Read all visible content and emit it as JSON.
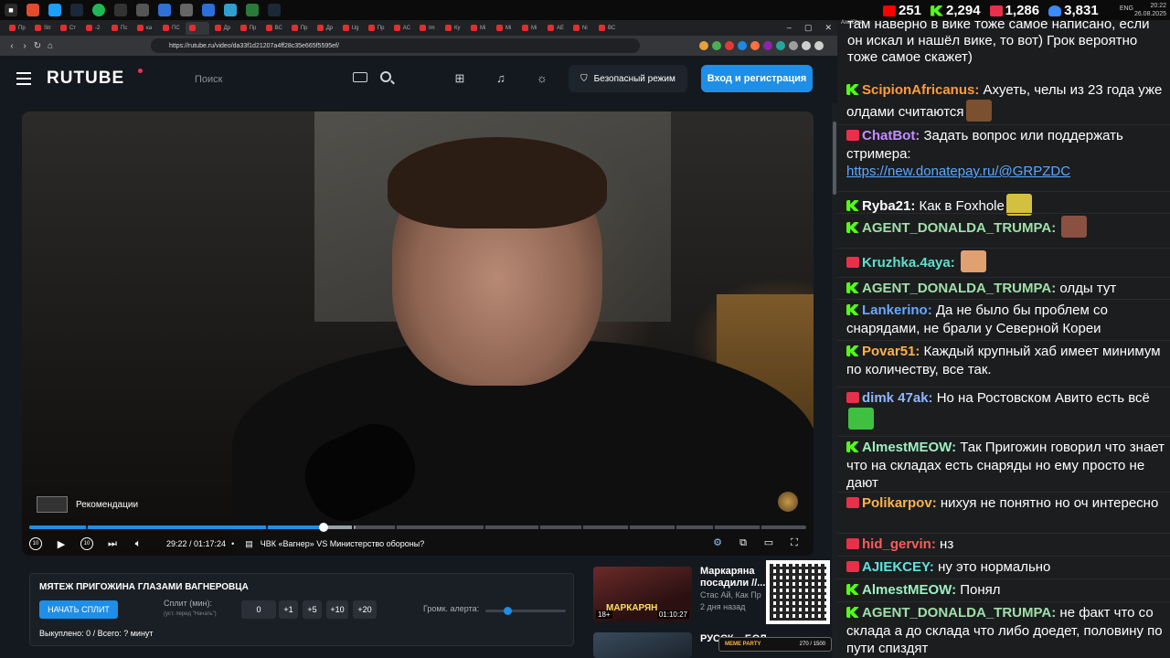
{
  "taskbar": {
    "lang": "ENG",
    "time": "20:22",
    "date": "26.08.2025",
    "stats": [
      {
        "icon": "youtube-icon",
        "color": "#ff0000",
        "value": "251"
      },
      {
        "icon": "kick-icon",
        "color": "#53fc18",
        "value": "2,294"
      },
      {
        "icon": "live-icon",
        "color": "#e8304a",
        "value": "1,286"
      },
      {
        "icon": "viewers-icon",
        "color": "#3b8bff",
        "value": "3,831"
      }
    ]
  },
  "browser": {
    "tabs": [
      "Пр",
      "Str",
      "Ст",
      "-2",
      "Пс",
      "ка",
      "ПС",
      "",
      "Др",
      "Пр",
      "ВС",
      "Пр",
      "Др",
      "Ug",
      "Пр",
      "АС",
      "Im",
      "Ку",
      "Mi",
      "Mi",
      "Mi",
      "АЕ",
      "Ni",
      "ВС"
    ],
    "url": "https://rutube.ru/video/da33f1d21207a4ff28c35e665f5595ef/"
  },
  "rutube": {
    "logo": "RUTUBE",
    "search_placeholder": "Поиск",
    "safe_mode": "Безопасный режим",
    "login": "Вход и регистрация",
    "recommendations": "Рекомендации",
    "player": {
      "time": "29:22 / 01:17:24",
      "separator": "•",
      "chapter": "ЧВК «Вагнер» VS Министерство обороны?",
      "progress_fraction": 0.379,
      "buffered_fraction": 0.42
    }
  },
  "split_panel": {
    "title": "МЯТЕЖ ПРИГОЖИНА ГЛАЗАМИ ВАГНЕРОВЦА",
    "start_button": "НАЧАТЬ СПЛИТ",
    "minutes_label": "Сплит (мин):",
    "hint": "(уст. перед \"Начать\")",
    "value": "0",
    "add_buttons": [
      "+1",
      "+5",
      "+10",
      "+20"
    ],
    "alert_label": "Громк. алерта:",
    "alert_volume_fraction": 0.27,
    "status": "Выкуплено: 0 / Всего: ? минут"
  },
  "related": [
    {
      "title": "Маркаряна посадили //...",
      "channel": "Стас Ай, Как Пр",
      "age": "2 дня назад",
      "age_rating": "18+",
      "duration": "01:10:27",
      "thumb_text": "МАРКАРЯН"
    },
    {
      "title": "РУССК... БОЛ..."
    }
  ],
  "meme_bar": {
    "label": "MEME PARTY",
    "progress": "270 / 1500"
  },
  "chat": {
    "app": "AxelChat",
    "top_cut": "там наверно в вике тоже самое написано, если он искал и нашёл вике, то вот) Грок вероятно тоже самое скажет)",
    "messages": [
      {
        "platform": "kick",
        "nick": "ScipionAfricanus",
        "color": "#ff9c3a",
        "text": "Ахуеть, челы из 23 года уже олдами считаются",
        "emote": "#7a5030"
      },
      {
        "platform": "live",
        "nick": "ChatBot",
        "color": "#c48bff",
        "text": "Задать вопрос или поддержать стримера:",
        "link": "https://new.donatepay.ru/@GRPZDC"
      },
      {
        "platform": "kick",
        "nick": "Ryba21",
        "color": "#ffffff",
        "text": "Как в Foxhole",
        "emote": "#d4c040"
      },
      {
        "platform": "kick",
        "nick": "AGENT_DONALDA_TRUMPA",
        "color": "#9ee0a8",
        "text": "",
        "emote": "#8a5040"
      },
      {
        "platform": "live",
        "nick": "Kruzhka.4aya",
        "color": "#5ee0c8",
        "text": "",
        "emote": "#e0a070"
      },
      {
        "platform": "kick",
        "nick": "AGENT_DONALDA_TRUMPA",
        "color": "#9ee0a8",
        "text": "олды тут"
      },
      {
        "platform": "kick",
        "nick": "Lankerino",
        "color": "#6aa8ff",
        "text": "Да не было бы проблем со снарядами, не брали у Северной Кореи"
      },
      {
        "platform": "kick",
        "nick": "Povar51",
        "color": "#ffb347",
        "text": "Каждый крупный хаб имеет минимум по количеству, все так."
      },
      {
        "platform": "live",
        "nick": "dimk 47ak",
        "color": "#8fb6ff",
        "text": "Но на Ростовском Авито есть всё",
        "emote": "#40c040"
      },
      {
        "platform": "kick",
        "nick": "AlmestMEOW",
        "color": "#9ef0c0",
        "text": "Так Пригожин говорил что знает что на складах есть снаряды но ему просто не дают"
      },
      {
        "platform": "live",
        "nick": "Polikarpov",
        "color": "#ffb347",
        "text": "нихуя не понятно но оч интересно"
      },
      {
        "platform": "live",
        "nick": "hid_gervin",
        "color": "#ff5a5a",
        "text": "нз"
      },
      {
        "platform": "live",
        "nick": "AJIEKCEY",
        "color": "#60e0e0",
        "text": "ну это нормально"
      },
      {
        "platform": "kick",
        "nick": "AlmestMEOW",
        "color": "#9ef0c0",
        "text": "Понял"
      },
      {
        "platform": "kick",
        "nick": "AGENT_DONALDA_TRUMPA",
        "color": "#9ee0a8",
        "text": "не факт что со склада а до склада что либо доедет, половину по пути спиздят"
      }
    ]
  }
}
